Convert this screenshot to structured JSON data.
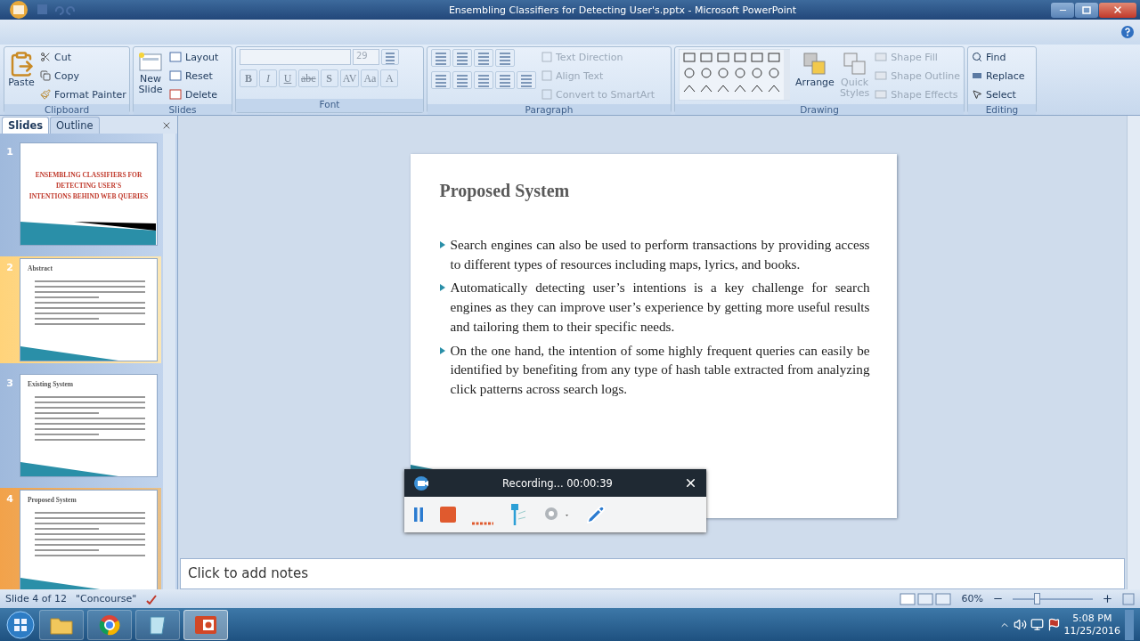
{
  "window": {
    "title": "Ensembling Classifiers for Detecting User's.pptx - Microsoft PowerPoint"
  },
  "ribbon": {
    "clipboard": {
      "label": "Clipboard",
      "large": "Paste",
      "small": [
        "Cut",
        "Copy",
        "Format Painter"
      ]
    },
    "slides": {
      "label": "Slides",
      "large": [
        "New",
        "Slide"
      ],
      "small": [
        "Layout",
        "Reset",
        "Delete"
      ]
    },
    "font": {
      "label": "Font",
      "size": "29",
      "format_buttons": [
        "B",
        "I",
        "U",
        "abc",
        "S",
        "AV",
        "Aa",
        "A"
      ]
    },
    "paragraph": {
      "label": "Paragraph",
      "commands": [
        {
          "label": "Text Direction",
          "disabled": true
        },
        {
          "label": "Align Text",
          "disabled": true
        },
        {
          "label": "Convert to SmartArt",
          "disabled": true
        }
      ]
    },
    "drawing": {
      "label": "Drawing",
      "large": [
        {
          "label": [
            "Arrange"
          ],
          "disabled": false
        },
        {
          "label": [
            "Quick",
            "Styles"
          ],
          "disabled": true
        }
      ],
      "commands": [
        {
          "label": "Shape Fill",
          "disabled": true
        },
        {
          "label": "Shape Outline",
          "disabled": true
        },
        {
          "label": "Shape Effects",
          "disabled": true
        }
      ]
    },
    "editing": {
      "label": "Editing",
      "commands": [
        "Find",
        "Replace",
        "Select"
      ]
    }
  },
  "slides_pane": {
    "tabs": [
      {
        "label": "Slides",
        "selected": true
      },
      {
        "label": "Outline",
        "selected": false
      }
    ],
    "thumbnails": [
      {
        "number": "1",
        "kind": "title",
        "title_lines": [
          "ENSEMBLING CLASSIFIERS FOR",
          "DETECTING USER'S",
          "INTENTIONS BEHIND WEB QUERIES"
        ],
        "selected": false,
        "hovered": false
      },
      {
        "number": "2",
        "kind": "content",
        "title_lines": [
          "Abstract"
        ],
        "selected": false,
        "hovered": true
      },
      {
        "number": "3",
        "kind": "content",
        "title_lines": [
          "Existing System"
        ],
        "selected": false,
        "hovered": false
      },
      {
        "number": "4",
        "kind": "content",
        "title_lines": [
          "Proposed System"
        ],
        "selected": true,
        "hovered": false
      }
    ]
  },
  "slide": {
    "title": "Proposed System",
    "bullets": [
      "Search engines can also be used to perform transactions by providing access to different types of resources including maps, lyrics, and books.",
      "Automatically detecting user’s intentions is a key challenge for search engines as they can improve user’s experience by getting more useful results and tailoring them to their specific needs.",
      " On the one hand, the intention of some highly frequent queries can easily be identified by benefiting from any type of hash table extracted from analyzing click patterns across search logs."
    ]
  },
  "recorder": {
    "status": "Recording... 00:00:39"
  },
  "notes": {
    "placeholder": "Click to add notes"
  },
  "status_bar": {
    "slide": "Slide 4 of 12",
    "theme": "\"Concourse\"",
    "zoom": "60%",
    "zoom_slider": {
      "level": 0.3
    }
  },
  "taskbar": {
    "apps": [
      {
        "kind": "folder",
        "selected": false
      },
      {
        "kind": "browser",
        "selected": false
      },
      {
        "kind": "notes",
        "selected": false
      },
      {
        "kind": "presentation",
        "selected": true
      }
    ],
    "time": "5:08 PM",
    "date": "11/25/2016"
  }
}
